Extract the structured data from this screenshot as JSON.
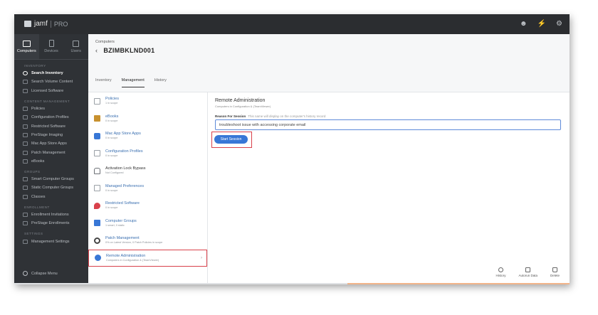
{
  "app": {
    "logo_text": "jamf",
    "logo_suffix": "PRO"
  },
  "topbar_icons": [
    "user-icon",
    "bolt-icon",
    "gear-icon"
  ],
  "sidebar": {
    "tabs": [
      {
        "label": "Computers",
        "icon": "laptop-icon"
      },
      {
        "label": "Devices",
        "icon": "phone-icon"
      },
      {
        "label": "Users",
        "icon": "users-icon"
      }
    ],
    "sections": {
      "inventory": "INVENTORY",
      "content": "CONTENT MANAGEMENT",
      "groups": "GROUPS",
      "enrollment": "ENROLLMENT",
      "settings": "SETTINGS"
    },
    "inventory_items": [
      "Search Inventory",
      "Search Volume Content",
      "Licensed Software"
    ],
    "content_items": [
      "Policies",
      "Configuration Profiles",
      "Restricted Software",
      "PreStage Imaging",
      "Mac App Store Apps",
      "Patch Management",
      "eBooks"
    ],
    "group_items": [
      "Smart Computer Groups",
      "Static Computer Groups",
      "Classes"
    ],
    "enrollment_items": [
      "Enrollment Invitations",
      "PreStage Enrollments"
    ],
    "settings_items": [
      "Management Settings"
    ],
    "collapse_label": "Collapse Menu"
  },
  "header": {
    "breadcrumb": "Computers",
    "back": "‹",
    "title": "BZIMBKLND001",
    "tabs": [
      "Inventory",
      "Management",
      "History"
    ]
  },
  "list": [
    {
      "title": "Policies",
      "sub": "1 in scope",
      "color": "#9aa0a6"
    },
    {
      "title": "eBooks",
      "sub": "0 in scope",
      "color": "#c8912f"
    },
    {
      "title": "Mac App Store Apps",
      "sub": "0 in scope",
      "color": "#3877d6"
    },
    {
      "title": "Configuration Profiles",
      "sub": "0 in scope",
      "color": "#9aa0a6"
    },
    {
      "title": "Activation Lock Bypass",
      "sub": "Not Configured",
      "color": "#6c7075"
    },
    {
      "title": "Managed Preferences",
      "sub": "0 in scope",
      "color": "#9aa0a6"
    },
    {
      "title": "Restricted Software",
      "sub": "0 in scope",
      "color": "#d9414b"
    },
    {
      "title": "Computer Groups",
      "sub": "1 smart, 0 static",
      "color": "#3877d6"
    },
    {
      "title": "Patch Management",
      "sub": "0% on Latest Version, 0 Patch Policies in scope",
      "color": "#444"
    },
    {
      "title": "Remote Administration",
      "sub": "Computers in Configuration & (TeamViewer)",
      "color": "#3877d6"
    }
  ],
  "detail": {
    "title": "Remote Administration",
    "subtitle": "Computers in Configuration & (TeamViewer)",
    "label": "Reason For Session",
    "hint": "This name will display on the computer's history record",
    "input_value": "troubleshoot issue with accessing corporate email",
    "button": "Start Session"
  },
  "footer": [
    {
      "label": "History",
      "icon": "history-icon"
    },
    {
      "label": "Autorun Data",
      "icon": "autorun-icon"
    },
    {
      "label": "Delete",
      "icon": "trash-icon"
    }
  ]
}
